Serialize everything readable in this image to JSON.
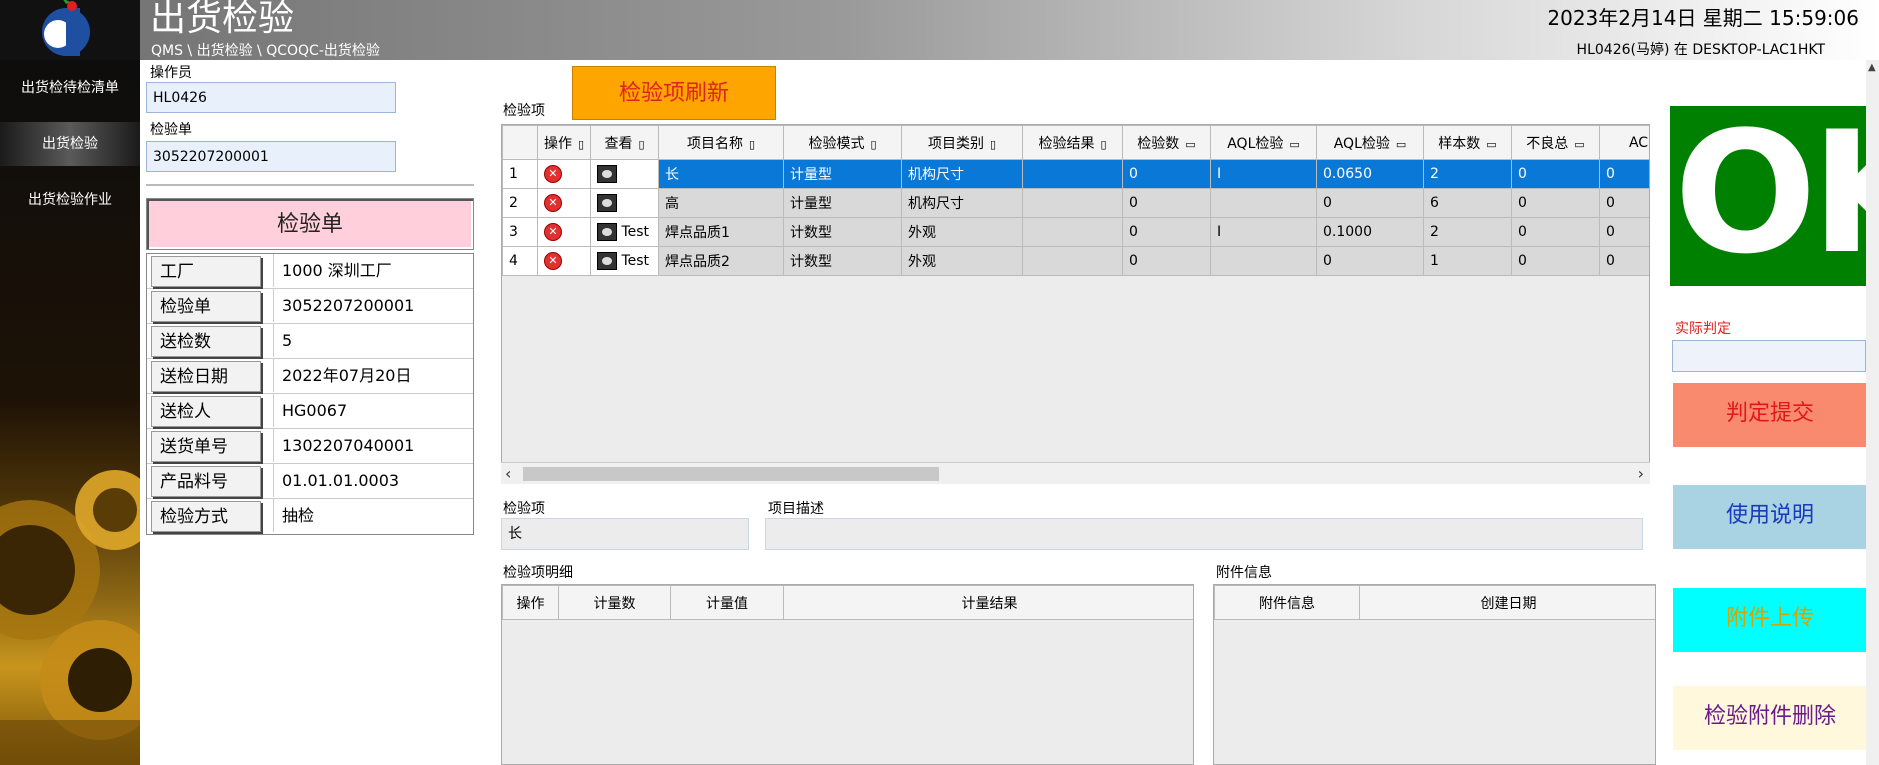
{
  "header": {
    "title": "出货检验",
    "breadcrumb": "QMS \\ 出货检验 \\ QCOQC-出货检验",
    "datetime": "2023年2月14日 星期二 15:59:06",
    "user_host": "HL0426(马婷) 在 DESKTOP-LAC1HKT"
  },
  "sidebar": {
    "items": [
      {
        "label": "出货检待检清单"
      },
      {
        "label": "出货检验"
      },
      {
        "label": "出货检验作业"
      }
    ]
  },
  "form": {
    "operator_label": "操作员",
    "operator_value": "HL0426",
    "order_label": "检验单",
    "order_value": "3052207200001"
  },
  "doc": {
    "title": "检验单",
    "rows": [
      {
        "key": "工厂",
        "value": "1000 深圳工厂"
      },
      {
        "key": "检验单",
        "value": "3052207200001"
      },
      {
        "key": "送检数",
        "value": "5"
      },
      {
        "key": "送检日期",
        "value": "2022年07月20日"
      },
      {
        "key": "送检人",
        "value": "HG0067"
      },
      {
        "key": "送货单号",
        "value": "1302207040001"
      },
      {
        "key": "产品料号",
        "value": "01.01.01.0003"
      },
      {
        "key": "检验方式",
        "value": "抽检"
      }
    ]
  },
  "grid": {
    "section_label": "检验项",
    "refresh_label": "检验项刷新",
    "columns": [
      "操作",
      "查看",
      "项目名称",
      "检验模式",
      "项目类别",
      "检验结果",
      "检验数",
      "AQL检验",
      "AQL检验",
      "样本数",
      "不良总",
      "AC"
    ],
    "rows": [
      {
        "no": "1",
        "view": "",
        "name": "长",
        "mode": "计量型",
        "category": "机构尺寸",
        "result": "",
        "count": "0",
        "aql_level": "I",
        "aql_value": "0.0650",
        "sample": "2",
        "defects": "0",
        "ac": "0"
      },
      {
        "no": "2",
        "view": "",
        "name": "高",
        "mode": "计量型",
        "category": "机构尺寸",
        "result": "",
        "count": "0",
        "aql_level": "",
        "aql_value": "0",
        "sample": "6",
        "defects": "0",
        "ac": "0"
      },
      {
        "no": "3",
        "view": "Test",
        "name": "焊点品质1",
        "mode": "计数型",
        "category": "外观",
        "result": "",
        "count": "0",
        "aql_level": "I",
        "aql_value": "0.1000",
        "sample": "2",
        "defects": "0",
        "ac": "0"
      },
      {
        "no": "4",
        "view": "Test",
        "name": "焊点品质2",
        "mode": "计数型",
        "category": "外观",
        "result": "",
        "count": "0",
        "aql_level": "",
        "aql_value": "0",
        "sample": "1",
        "defects": "0",
        "ac": "0"
      }
    ]
  },
  "item_detail": {
    "item_label": "检验项",
    "item_value": "长",
    "desc_label": "项目描述",
    "desc_value": ""
  },
  "measure": {
    "label": "检验项明细",
    "columns": [
      "操作",
      "计量数",
      "计量值",
      "计量结果"
    ]
  },
  "attach": {
    "label": "附件信息",
    "columns": [
      "附件信息",
      "创建日期"
    ]
  },
  "right": {
    "verdict": "OK",
    "verdict_color": "#008000",
    "judge_label": "实际判定",
    "judge_value": "",
    "buttons": [
      {
        "label": "判定提交",
        "bg": "#fa8a6e",
        "color": "#e01818"
      },
      {
        "label": "使用说明",
        "bg": "#a9d3e3",
        "color": "#1a3ab8"
      },
      {
        "label": "附件上传",
        "bg": "#00ffff",
        "color": "#d4a400"
      },
      {
        "label": "检验附件删除",
        "bg": "#fff8dc",
        "color": "#6a1a8a"
      }
    ]
  }
}
